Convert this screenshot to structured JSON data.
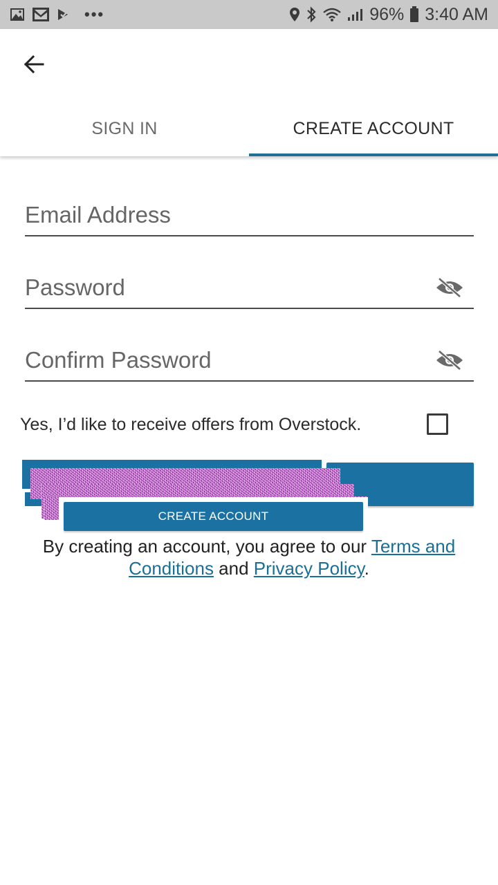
{
  "status_bar": {
    "battery": "96%",
    "time": "3:40 AM",
    "icons_left": [
      "gallery-icon",
      "gmail-icon",
      "tasks-icon",
      "more-dots"
    ],
    "icons_right": [
      "location-icon",
      "bluetooth-icon",
      "wifi-icon",
      "signal-icon",
      "battery-icon"
    ],
    "dots": "•••"
  },
  "app_bar": {
    "back_icon": "arrow-left-icon"
  },
  "tabs": [
    {
      "label": "SIGN IN",
      "active": false
    },
    {
      "label": "CREATE ACCOUNT",
      "active": true
    }
  ],
  "form": {
    "email": {
      "placeholder": "Email Address",
      "value": ""
    },
    "password": {
      "placeholder": "Password",
      "value": "",
      "toggle_icon": "eye-off-icon"
    },
    "confirm_password": {
      "placeholder": "Confirm Password",
      "value": "",
      "toggle_icon": "eye-off-icon"
    },
    "opt_in": {
      "label": "Yes, I’d like to receive offers from Overstock.",
      "checked": false
    },
    "submit_label": "CREATE ACCOUNT"
  },
  "terms": {
    "prefix": "By creating an account, you agree to our ",
    "terms_link": "Terms and Conditions",
    "middle": " and ",
    "privacy_link": "Privacy Policy",
    "suffix": "."
  },
  "colors": {
    "accent": "#1b71a2",
    "link": "#1b6f96",
    "status_bar_bg": "#c9c9c9"
  }
}
